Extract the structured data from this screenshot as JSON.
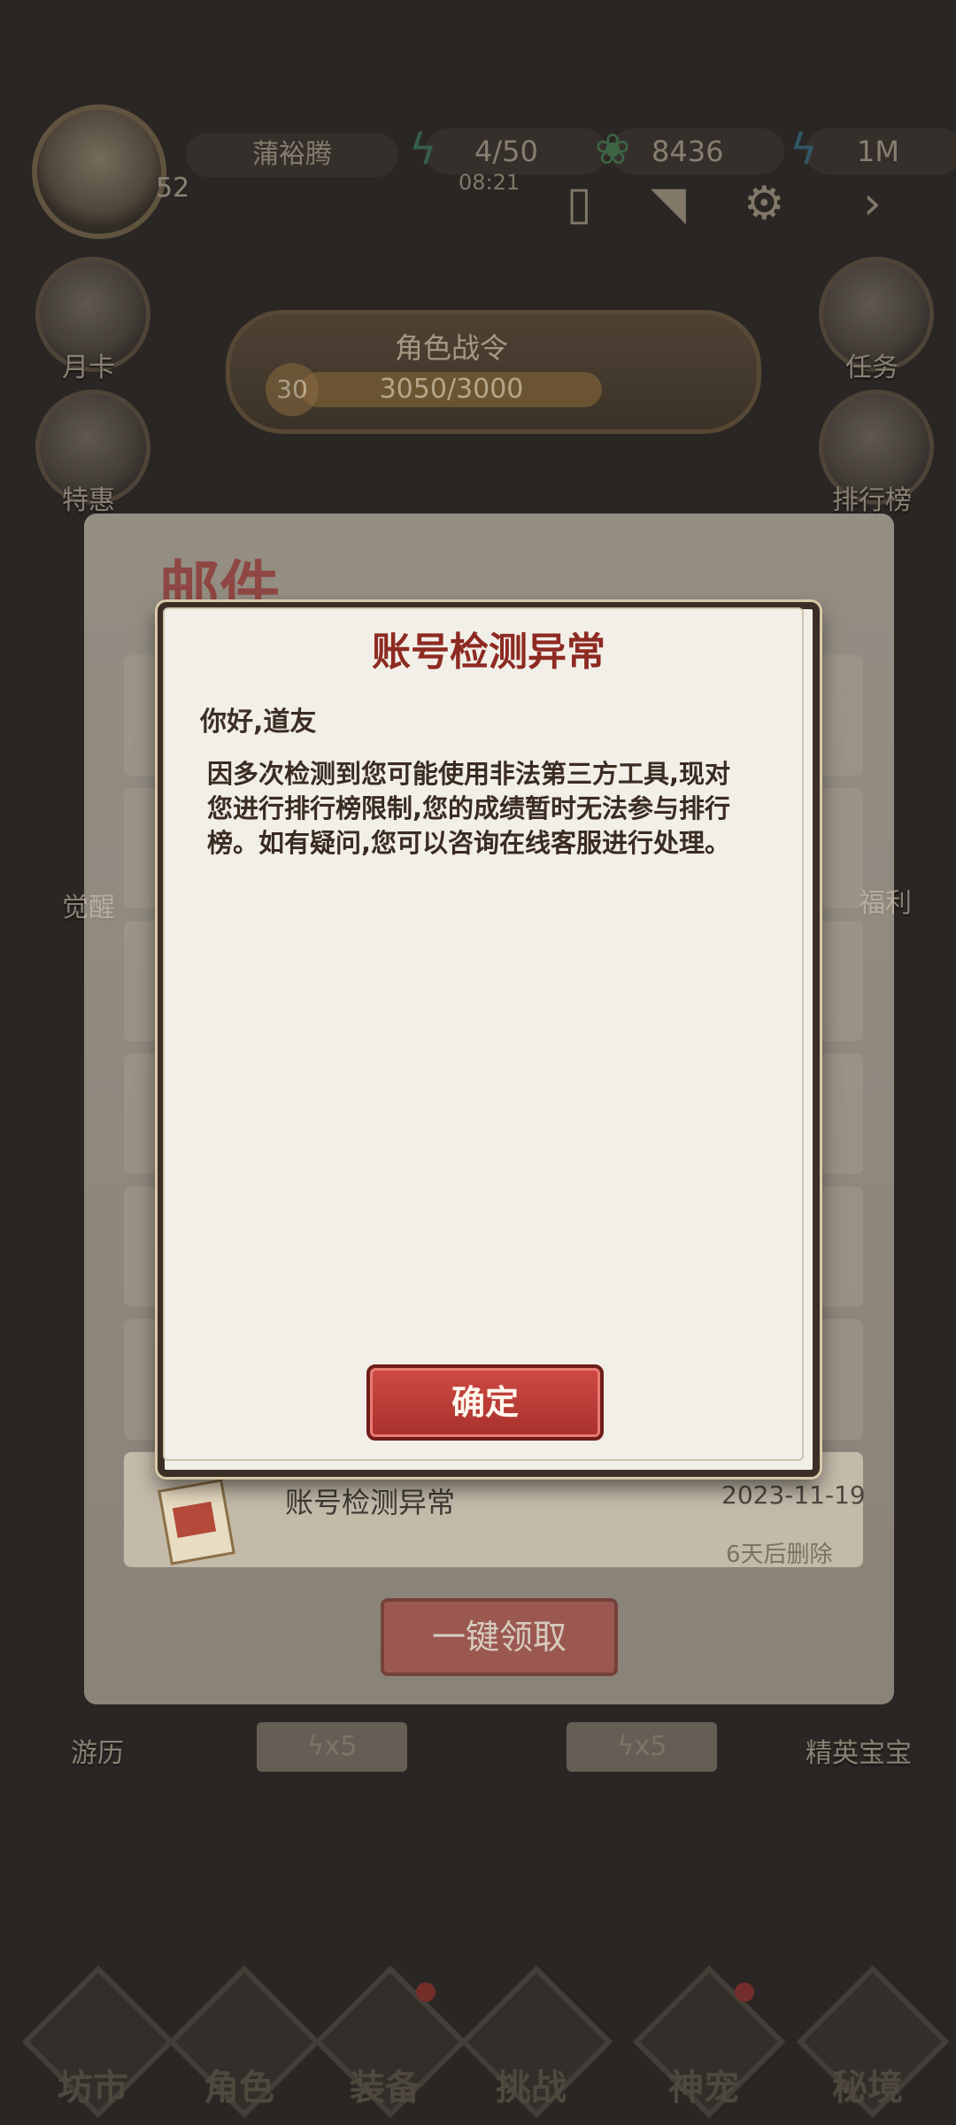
{
  "player": {
    "name": "蒲裕腾",
    "level": "52"
  },
  "resources": {
    "energy": "4/50",
    "energy_timer": "08:21",
    "jade": "8436",
    "other": "1M"
  },
  "sidebar_left": [
    {
      "label": "月卡"
    },
    {
      "label": "特惠"
    },
    {
      "label": "觉醒"
    },
    {
      "label": "游历"
    }
  ],
  "sidebar_right": [
    {
      "label": "任务"
    },
    {
      "label": "排行榜"
    },
    {
      "label": "福利"
    },
    {
      "label": "精英宝宝"
    }
  ],
  "battle_pass": {
    "title": "角色战令",
    "level": "30",
    "progress_text": "3050/3000",
    "progress_fraction": 1.0
  },
  "mail": {
    "title": "邮件",
    "visible_item": {
      "name": "账号检测异常",
      "date": "2023-11-19",
      "expiry": "6天后删除"
    },
    "claim_all_label": "一键领取",
    "energy_slots": [
      "x5",
      "x5"
    ]
  },
  "bottom_nav": [
    {
      "label": "坊市",
      "badge": false
    },
    {
      "label": "角色",
      "badge": false
    },
    {
      "label": "装备",
      "badge": true
    },
    {
      "label": "挑战",
      "badge": false
    },
    {
      "label": "神宠",
      "badge": true
    },
    {
      "label": "秘境",
      "badge": false
    }
  ],
  "dialog": {
    "title": "账号检测异常",
    "greeting": "你好,道友",
    "body": "因多次检测到您可能使用非法第三方工具,现对您进行排行榜限制,您的成绩暂时无法参与排行榜。如有疑问,您可以咨询在线客服进行处理。",
    "confirm_label": "确定"
  },
  "colors": {
    "dialog_title": "#8d2a22",
    "confirm_button": "#b7372f",
    "overlay": "#2a2624"
  }
}
